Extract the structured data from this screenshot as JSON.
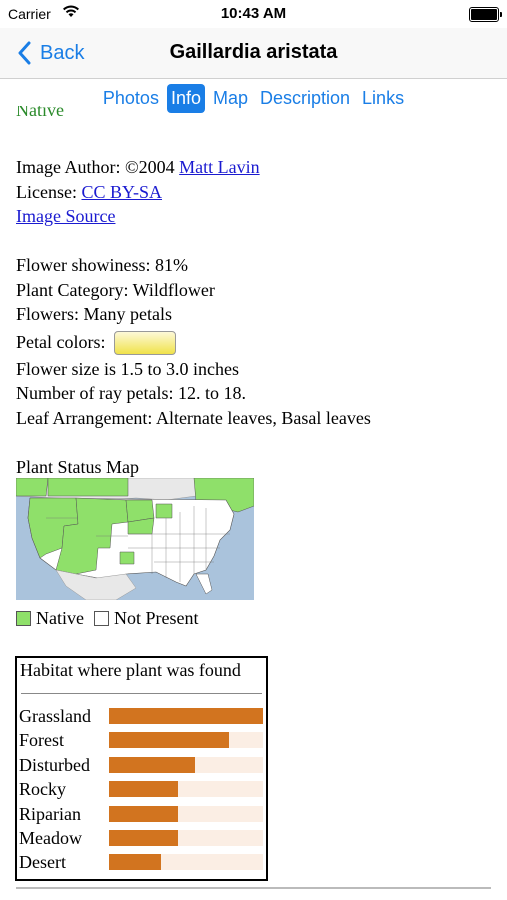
{
  "status": {
    "carrier": "Carrier",
    "time": "10:43 AM"
  },
  "nav": {
    "back_label": "Back",
    "title": "Gaillardia aristata"
  },
  "tabs": [
    {
      "label": "Photos",
      "active": false
    },
    {
      "label": "Info",
      "active": true
    },
    {
      "label": "Map",
      "active": false
    },
    {
      "label": "Description",
      "active": false
    },
    {
      "label": "Links",
      "active": false
    }
  ],
  "info": {
    "native_partial": "Native",
    "author_prefix": "Image Author: ©2004 ",
    "author_name": "Matt Lavin",
    "license_prefix": "License: ",
    "license_name": "CC BY-SA",
    "image_source": "Image Source",
    "showiness": "Flower showiness: 81%",
    "category": "Plant Category: Wildflower",
    "flowers": "Flowers: Many petals",
    "petal_colors": "Petal colors:",
    "flower_size": "Flower size is 1.5 to 3.0 inches",
    "ray_petals": "Number of ray petals: 12. to 18.",
    "leaf": "Leaf Arrangement: Alternate leaves, Basal leaves",
    "status_map_title": "Plant Status Map"
  },
  "legend": {
    "native": "Native",
    "not_present": "Not Present"
  },
  "colors": {
    "accent": "#1a7ee6",
    "native": "#8fe06a",
    "bar": "#d2741f",
    "bar_track": "#fbeee4",
    "ocean": "#aac3dc"
  },
  "habitat": {
    "title": "Habitat where plant was found",
    "rows": [
      {
        "label": "Grassland",
        "value": 1.0
      },
      {
        "label": "Forest",
        "value": 0.78
      },
      {
        "label": "Disturbed",
        "value": 0.56
      },
      {
        "label": "Rocky",
        "value": 0.45
      },
      {
        "label": "Riparian",
        "value": 0.45
      },
      {
        "label": "Meadow",
        "value": 0.45
      },
      {
        "label": "Desert",
        "value": 0.34
      }
    ]
  }
}
